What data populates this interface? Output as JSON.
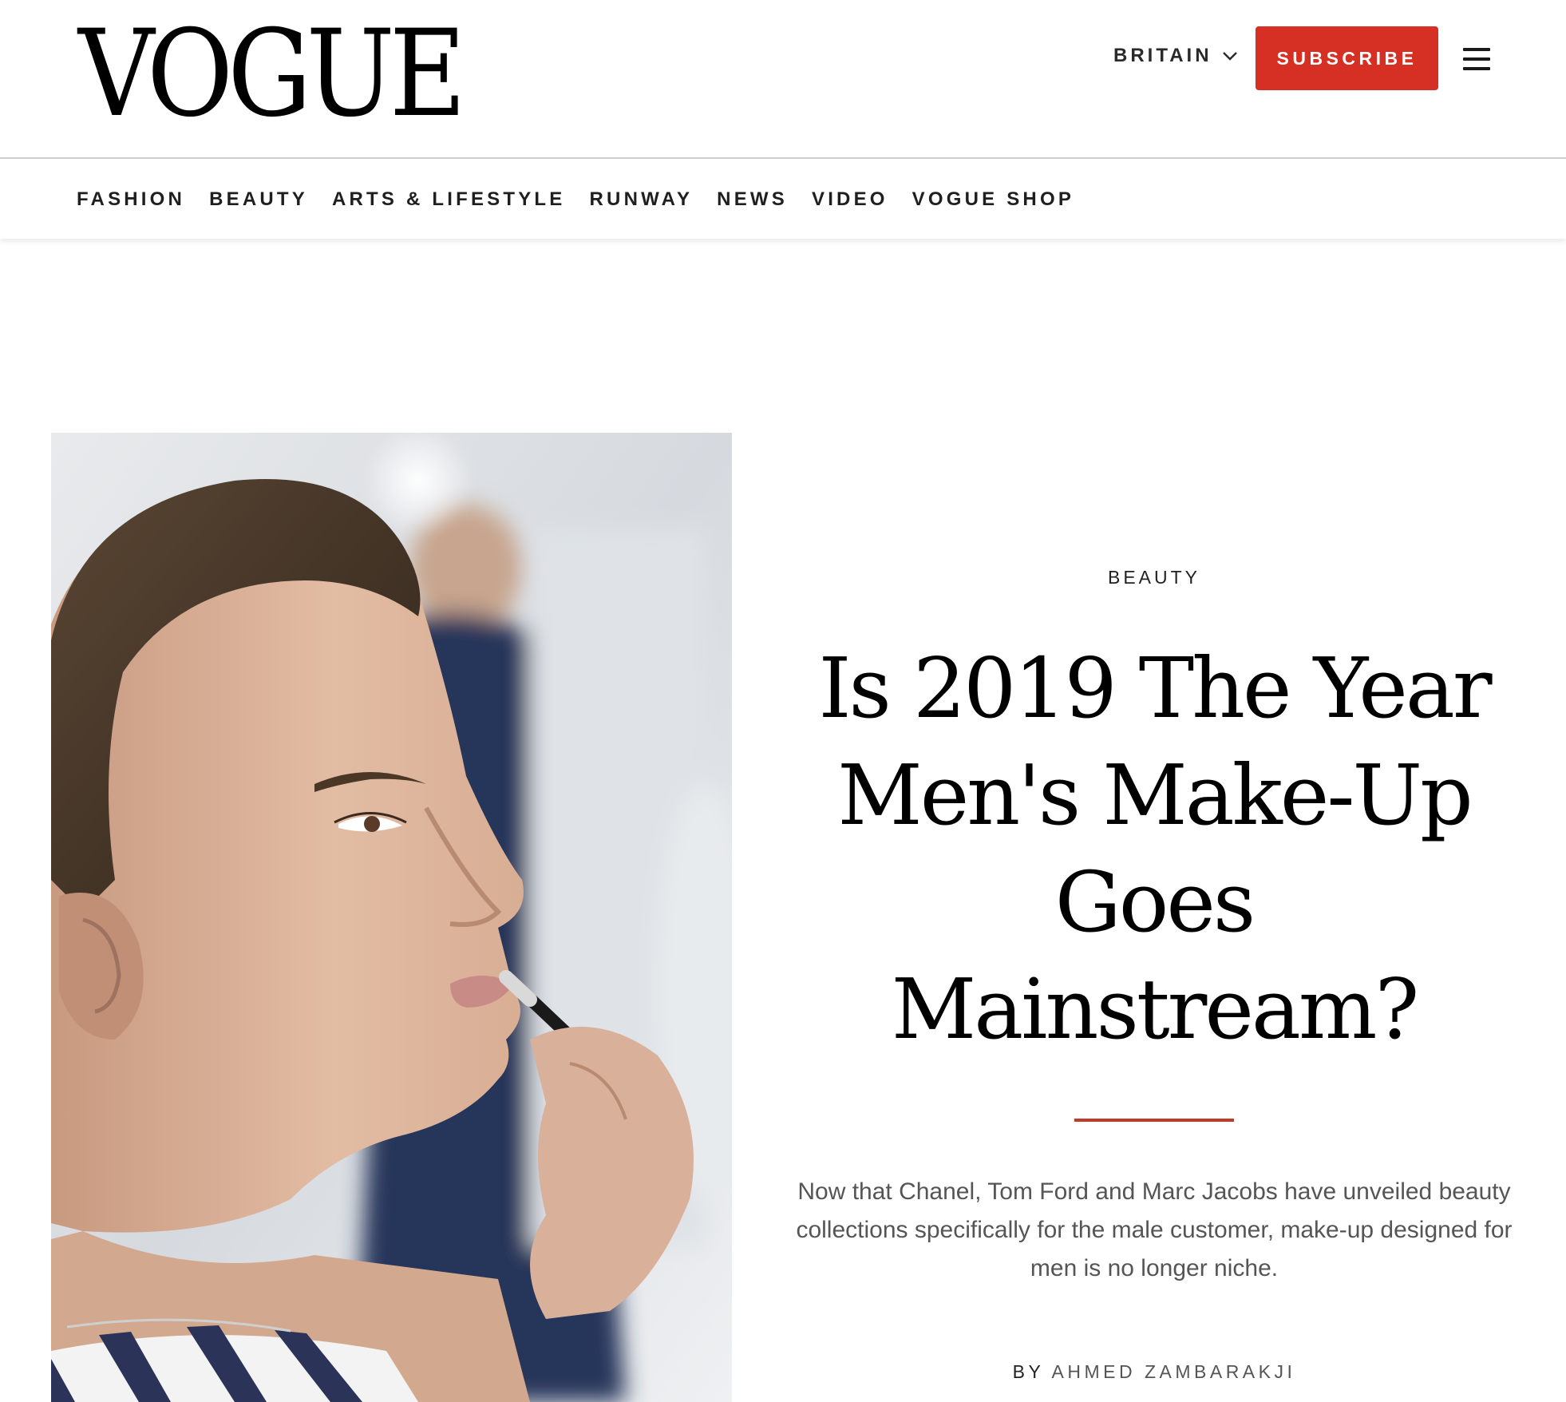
{
  "header": {
    "logo_text": "VOGUE",
    "edition_label": "BRITAIN",
    "subscribe_label": "SUBSCRIBE",
    "brand_red": "#d62f23",
    "menu_icon": "hamburger-menu-icon",
    "edition_icon": "chevron-down-icon"
  },
  "nav": {
    "items": [
      "FASHION",
      "BEAUTY",
      "ARTS & LIFESTYLE",
      "RUNWAY",
      "NEWS",
      "VIDEO",
      "VOGUE SHOP"
    ]
  },
  "article": {
    "category": "BEAUTY",
    "headline": "Is 2019 The Year Men's Make-Up Goes Mainstream?",
    "dek": "Now that Chanel, Tom Ford and Marc Jacobs have unveiled beauty collections specifically for the male customer, make-up designed for men is no longer niche.",
    "byline_prefix": "BY",
    "author": "AHMED ZAMBARAKJI",
    "divider_color": "#c0392b"
  }
}
